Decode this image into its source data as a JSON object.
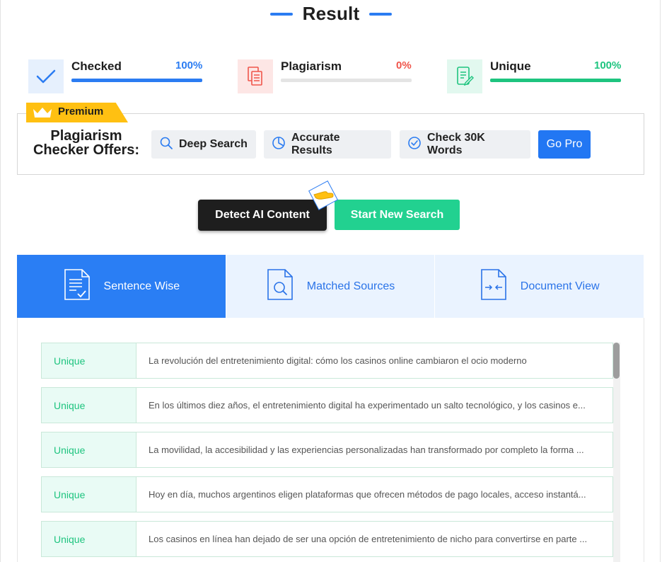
{
  "header": {
    "title": "Result"
  },
  "stats": [
    {
      "label": "Checked",
      "value": "100%",
      "fraction": 1.0,
      "color": "#2b7cf2",
      "icon": "check-icon"
    },
    {
      "label": "Plagiarism",
      "value": "0%",
      "fraction": 0.0,
      "color": "#f0554b",
      "icon": "copy-document-icon"
    },
    {
      "label": "Unique",
      "value": "100%",
      "fraction": 1.0,
      "color": "#1ec47f",
      "icon": "edit-document-icon"
    }
  ],
  "premium": {
    "tag": "Premium",
    "offers_title_line1": "Plagiarism",
    "offers_title_line2": "Checker Offers:",
    "features": [
      "Deep Search",
      "Accurate Results",
      "Check 30K Words"
    ],
    "go_pro": "Go Pro"
  },
  "actions": {
    "detect_ai": "Detect AI Content",
    "new_search": "Start New Search"
  },
  "tabs": [
    "Sentence Wise",
    "Matched Sources",
    "Document View"
  ],
  "results": [
    {
      "status": "Unique",
      "text": "La revolución del entretenimiento digital: cómo los casinos online cambiaron el ocio moderno"
    },
    {
      "status": "Unique",
      "text": "En los últimos diez años, el entretenimiento digital ha experimentado un salto tecnológico, y los casinos e..."
    },
    {
      "status": "Unique",
      "text": "La movilidad, la accesibilidad y las experiencias personalizadas han transformado por completo la forma ..."
    },
    {
      "status": "Unique",
      "text": "Hoy en día, muchos argentinos eligen plataformas que ofrecen métodos de pago locales, acceso instantá..."
    },
    {
      "status": "Unique",
      "text": "Los casinos en línea han dejado de ser una opción de entretenimiento de nicho para convertirse en parte ..."
    }
  ],
  "colors": {
    "accent": "#2a7ef4",
    "success": "#1ec47f",
    "danger": "#f0554b",
    "premium": "#ffc012"
  }
}
